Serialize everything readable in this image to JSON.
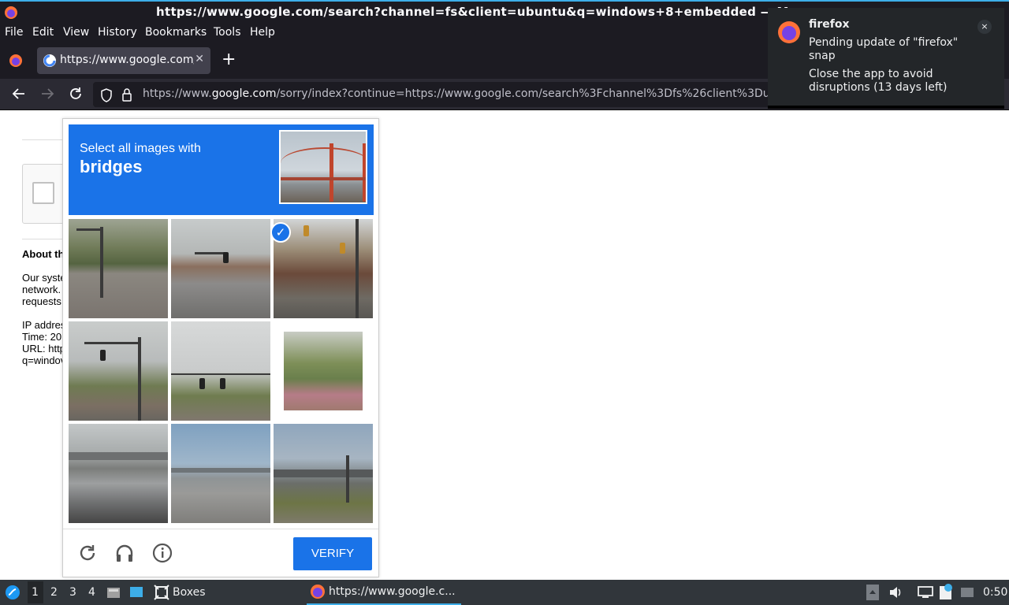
{
  "window": {
    "title": "https://www.google.com/search?channel=fs&client=ubuntu&q=windows+8+embedded — M"
  },
  "menu": [
    "File",
    "Edit",
    "View",
    "History",
    "Bookmarks",
    "Tools",
    "Help"
  ],
  "tab": {
    "label": "https://www.google.com/",
    "close": "✕"
  },
  "newtab": "+",
  "url": {
    "prefix": "https://www.",
    "domain": "google.com",
    "rest": "/sorry/index?continue=https://www.google.com/search%3Fchannel%3Dfs%26client%3Du"
  },
  "page": {
    "about": "About th",
    "lines": [
      "Our syste",
      "network.",
      "requests"
    ],
    "ip": "IP addres",
    "time": "Time: 20",
    "urlline": "URL: http",
    "q": "q=windov"
  },
  "captcha": {
    "instruction": "Select all images with",
    "target": "bridges",
    "verify": "VERIFY",
    "selected_tile": 5,
    "check": "✓"
  },
  "notification": {
    "app": "firefox",
    "line1": "Pending update of \"firefox\" snap",
    "line2": "Close the app to avoid disruptions (13 days left)",
    "close": "×"
  },
  "taskbar": {
    "desktops": [
      "1",
      "2",
      "3",
      "4"
    ],
    "boxes": "Boxes",
    "task": "https://www.google.c...",
    "clock": "0:50"
  },
  "colors": {
    "accent": "#1a73e8",
    "chrome": "#1c1b22",
    "panel": "#31363b"
  }
}
